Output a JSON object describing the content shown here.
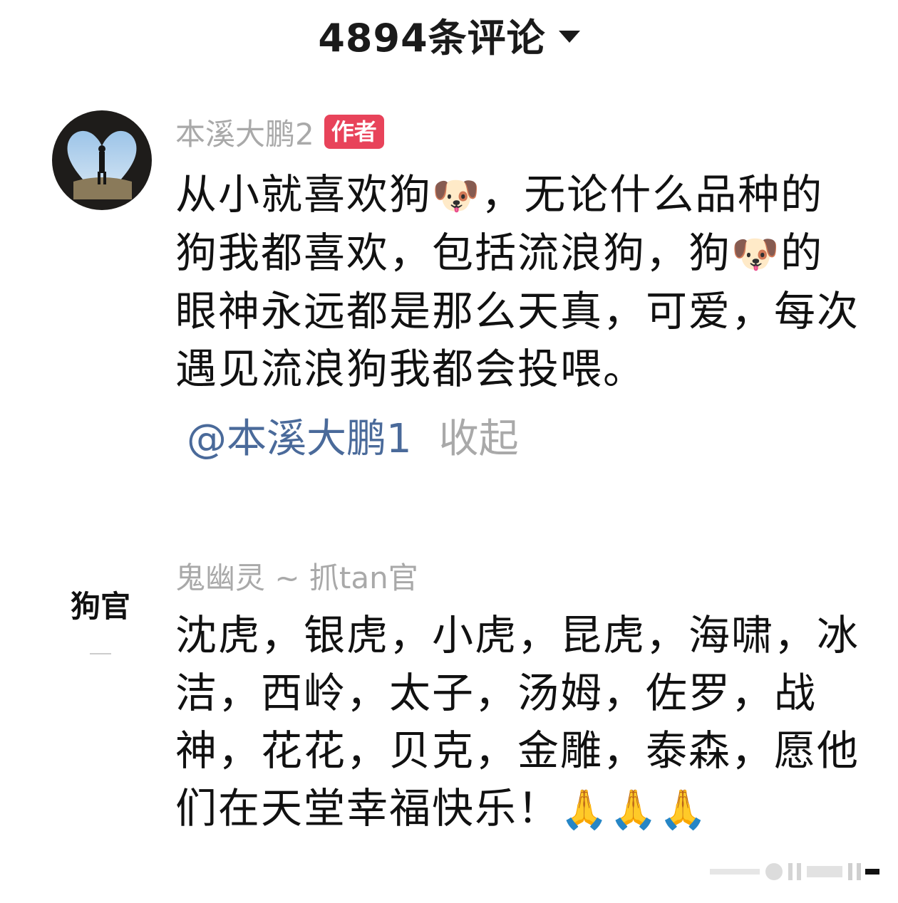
{
  "header": {
    "title": "4894条评论",
    "dropdown_icon": "caret-down-icon"
  },
  "comments": [
    {
      "username": "本溪大鹏2",
      "badge": "作者",
      "avatar_icon": "avatar-photo",
      "text_parts": [
        "从小就喜欢狗",
        "🐶",
        "，无论什么品种的狗我都喜欢，包括流浪狗，狗",
        "🐶",
        "的眼神永远都是那么天真，可爱，每次遇见流浪狗我都会投喂。"
      ],
      "reply_to": "@本溪大鹏1",
      "collapse_label": "收起"
    },
    {
      "username": "鬼幽灵 ~ 抓tan官",
      "avatar_icon": "calligraphy-logo",
      "avatar_text": "狗官",
      "text_parts": [
        "沈虎，银虎，小虎，昆虎，海啸，冰洁，西岭，太子，汤姆，佐罗，战神，花花，贝克，金雕，泰森，愿他们在天堂幸福快乐！",
        "🙏🙏🙏"
      ]
    }
  ],
  "colors": {
    "badge": "#e8435a",
    "mention": "#4a6a9a",
    "muted": "#a9a9a9"
  }
}
